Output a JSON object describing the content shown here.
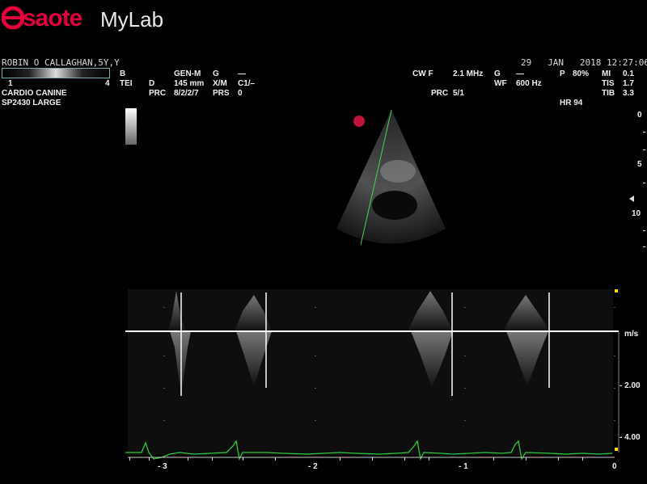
{
  "logo": {
    "brand": "saote",
    "product": "MyLab"
  },
  "patient": {
    "name": "ROBIN O CALLAGHAN,5Y,Y"
  },
  "datetime": {
    "day": "29",
    "month": "JAN",
    "year": "2018",
    "time": "12:27:06"
  },
  "graybar": {
    "min": "1",
    "max": "4"
  },
  "exam": {
    "preset": "CARDIO CANINE",
    "probe": "SP2430   LARGE"
  },
  "bmode": {
    "mode": "B",
    "tei": "TEI",
    "gen": "GEN-M",
    "g_label": "G",
    "g_val": "—",
    "d_label": "D",
    "d_val": "145 mm",
    "xm_label": "X/M",
    "xm_val": "C1/–",
    "prc_label": "PRC",
    "prc_val": "8/2/2/7",
    "prs_label": "PRS",
    "prs_val": "0"
  },
  "doppler": {
    "mode": "CW F",
    "freq": "2.1 MHz",
    "g_label": "G",
    "g_val": "—",
    "wf_label": "WF",
    "wf_val": "600 Hz",
    "prc_label": "PRC",
    "prc_val": "5/1",
    "p_label": "P",
    "p_val": "80%"
  },
  "safety": {
    "mi_label": "MI",
    "mi_val": "0.1",
    "tis_label": "TIS",
    "tis_val": "1.7",
    "tib_label": "TIB",
    "tib_val": "3.3",
    "hr": "HR 94"
  },
  "depth_scale": [
    "0",
    "5",
    "10"
  ],
  "velocity_scale": {
    "unit": "m/s",
    "ticks": [
      "- 2.00",
      "- 4.00"
    ]
  },
  "time_scale": [
    "- 3",
    "- 2",
    "- 1",
    "0"
  ],
  "colors": {
    "background": "#000000",
    "ecg": "#2ec83a",
    "cursor_line": "#4bd24b",
    "brand": "#e0003c"
  }
}
